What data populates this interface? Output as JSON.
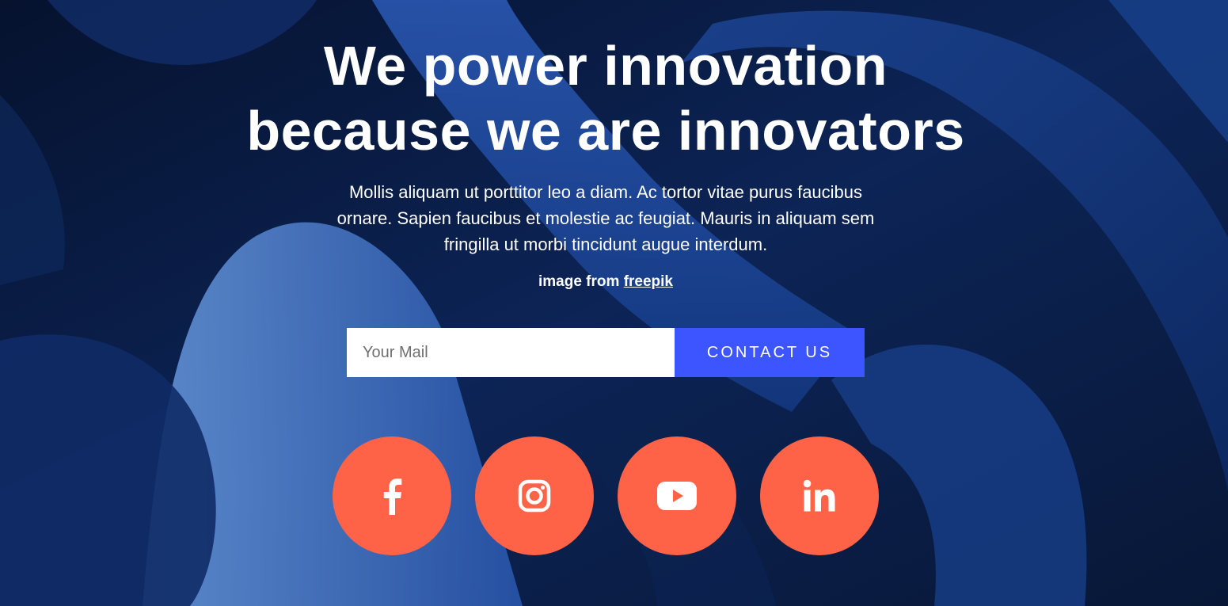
{
  "hero": {
    "headline_line1": "We power innovation",
    "headline_line2": "because we are innovators",
    "subtext": "Mollis aliquam ut porttitor leo a diam. Ac tortor vitae purus faucibus ornare. Sapien faucibus et molestie ac feugiat. Mauris in aliquam sem fringilla ut morbi tincidunt augue interdum.",
    "credit_prefix": "image from",
    "credit_link": "freepik"
  },
  "form": {
    "email_placeholder": "Your Mail",
    "email_value": "",
    "contact_label": "CONTACT US"
  },
  "socials": [
    {
      "name": "facebook",
      "icon": "facebook-icon"
    },
    {
      "name": "instagram",
      "icon": "instagram-icon"
    },
    {
      "name": "youtube",
      "icon": "youtube-icon"
    },
    {
      "name": "linkedin",
      "icon": "linkedin-icon"
    }
  ],
  "colors": {
    "background": "#0a1a3c",
    "accent_button": "#3d55ff",
    "social_circle": "#ff6347",
    "text": "#ffffff"
  }
}
